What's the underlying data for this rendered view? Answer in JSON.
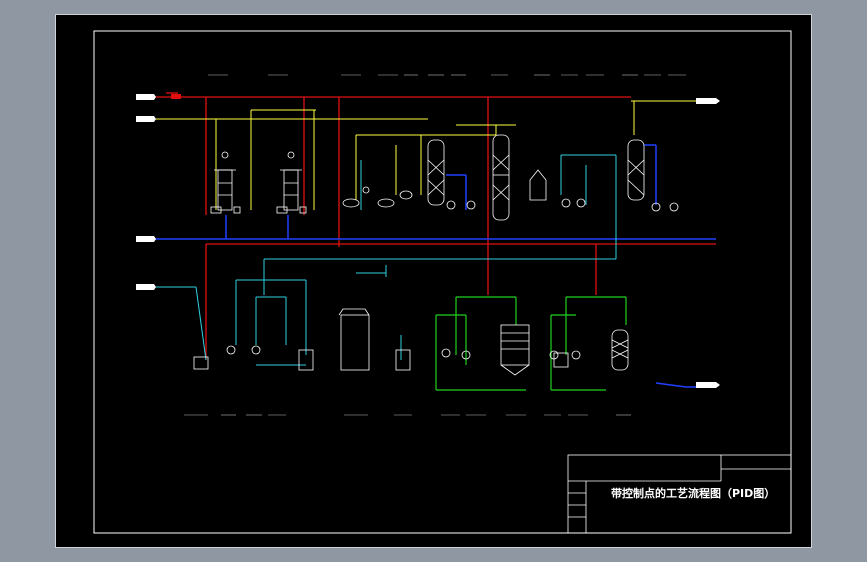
{
  "window": {
    "background": "#8f97a3",
    "canvas": "#000000"
  },
  "title_block": {
    "drawing_title": "带控制点的工艺流程图（PID图）"
  },
  "colors": {
    "steam": "#e01010",
    "water": "#ffff40",
    "cooling": "#2040ff",
    "process": "#30d0e0",
    "product": "#20d020",
    "frame": "#ffffff",
    "equipment": "#ffffff"
  }
}
